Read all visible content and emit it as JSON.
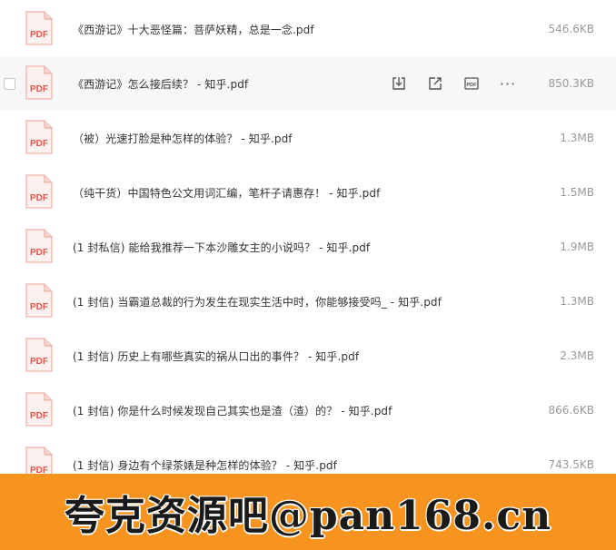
{
  "files": [
    {
      "name": "《西游记》十大恶怪篇：菩萨妖精，总是一念.pdf",
      "size": "546.6KB"
    },
    {
      "name": "《西游记》怎么接后续？ - 知乎.pdf",
      "size": "850.3KB",
      "hovered": true
    },
    {
      "name": "（被）光速打脸是种怎样的体验？ - 知乎.pdf",
      "size": "1.3MB"
    },
    {
      "name": "（纯干货）中国特色公文用词汇编，笔杆子请惠存！ - 知乎.pdf",
      "size": "1.5MB"
    },
    {
      "name": "(1 封私信) 能给我推荐一下本沙雕女主的小说吗？ - 知乎.pdf",
      "size": "1.9MB"
    },
    {
      "name": "(1 封信) 当霸道总裁的行为发生在现实生活中时，你能够接受吗_ - 知乎.pdf",
      "size": "1.3MB"
    },
    {
      "name": "(1 封信) 历史上有哪些真实的祸从口出的事件？ - 知乎.pdf",
      "size": "2.3MB"
    },
    {
      "name": "(1 封信) 你是什么时候发现自己其实也是渣（渣）的？ - 知乎.pdf",
      "size": "866.6KB"
    },
    {
      "name": "(1 封信) 身边有个绿茶婊是种怎样的体验？ - 知乎.pdf",
      "size": "743.5KB"
    }
  ],
  "icon_label": "PDF",
  "row_actions": [
    "download-icon",
    "share-icon",
    "pdf-preview-icon",
    "more-icon"
  ],
  "more_glyph": "···",
  "pdf_badge": "PDF",
  "watermark": "夸克资源吧@pan168.cn",
  "colors": {
    "accent_red": "#e2584d",
    "banner_orange": "#f6941f",
    "hover_bg": "#f7f7f9"
  }
}
